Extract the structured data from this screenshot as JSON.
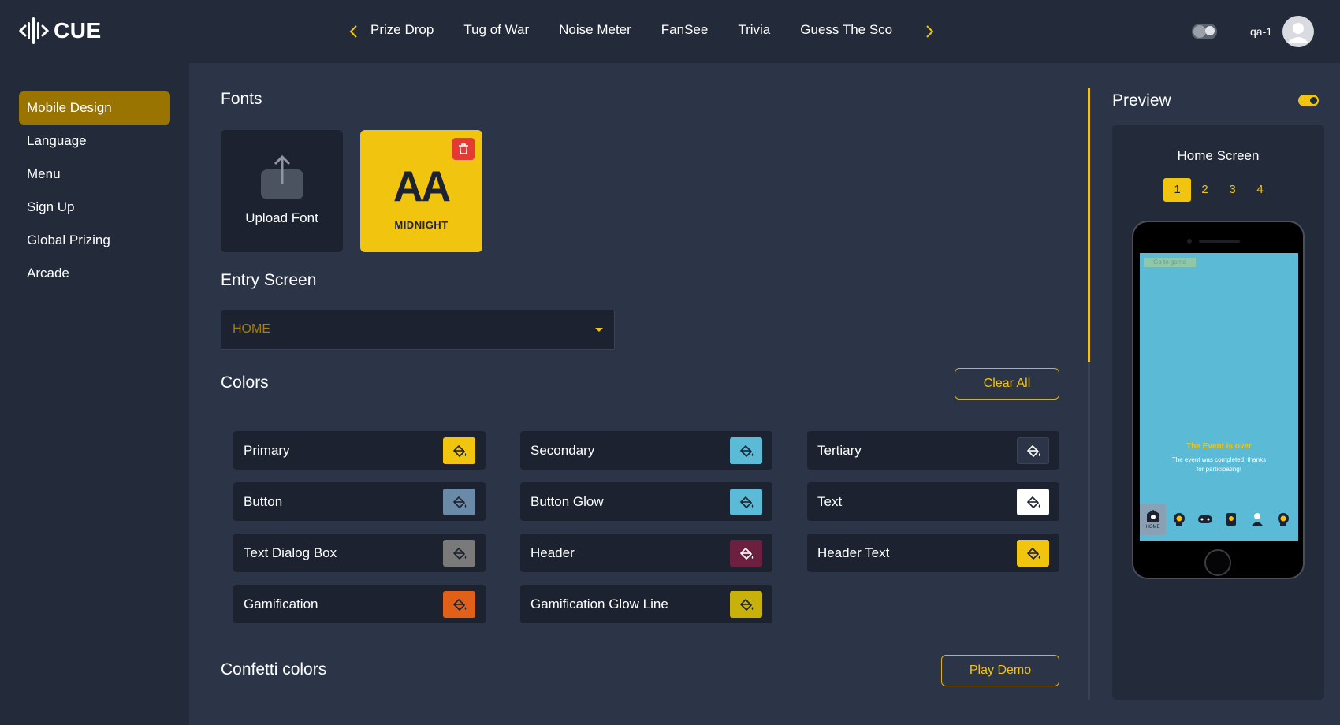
{
  "app": {
    "logo_text": "CUE"
  },
  "nav": {
    "tabs": [
      "Prize Drop",
      "Tug of War",
      "Noise Meter",
      "FanSee",
      "Trivia",
      "Guess The Sco"
    ]
  },
  "user": {
    "name": "qa-1"
  },
  "sidebar": {
    "items": [
      {
        "label": "Mobile Design",
        "active": true
      },
      {
        "label": "Language",
        "active": false
      },
      {
        "label": "Menu",
        "active": false
      },
      {
        "label": "Sign Up",
        "active": false
      },
      {
        "label": "Global Prizing",
        "active": false
      },
      {
        "label": "Arcade",
        "active": false
      }
    ]
  },
  "fonts": {
    "title": "Fonts",
    "upload_label": "Upload Font",
    "selected_font": {
      "preview": "AA",
      "name": "MIDNIGHT"
    }
  },
  "entry_screen": {
    "title": "Entry Screen",
    "value": "HOME"
  },
  "colors": {
    "title": "Colors",
    "clear_label": "Clear All",
    "items": [
      {
        "name": "Primary",
        "color": "#f1c40f",
        "icon": "paint-bucket-icon"
      },
      {
        "name": "Secondary",
        "color": "#5bbad5",
        "icon": "paint-bucket-icon"
      },
      {
        "name": "Tertiary",
        "color": "#2c3548",
        "icon": "paint-bucket-icon"
      },
      {
        "name": "Button",
        "color": "#6a8aa8",
        "icon": "paint-bucket-icon"
      },
      {
        "name": "Button Glow",
        "color": "#5bbad5",
        "icon": "paint-bucket-icon"
      },
      {
        "name": "Text",
        "color": "#ffffff",
        "icon": "paint-bucket-icon"
      },
      {
        "name": "Text Dialog Box",
        "color": "#7a7a7a",
        "icon": "paint-bucket-icon"
      },
      {
        "name": "Header",
        "color": "#6b2040",
        "icon": "paint-bucket-icon"
      },
      {
        "name": "Header Text",
        "color": "#f1c40f",
        "icon": "paint-bucket-icon"
      },
      {
        "name": "Gamification",
        "color": "#e0601a",
        "icon": "paint-bucket-icon"
      },
      {
        "name": "Gamification Glow Line",
        "color": "#c9b10c",
        "icon": "paint-bucket-icon"
      }
    ]
  },
  "confetti": {
    "title": "Confetti colors",
    "demo_label": "Play Demo"
  },
  "preview": {
    "title": "Preview",
    "screen_name": "Home Screen",
    "pages": [
      "1",
      "2",
      "3",
      "4"
    ],
    "active_page": "1",
    "phone": {
      "go_to_game": "Go to game",
      "event_title": "The Event is over",
      "event_message": "The event was completed, thanks for participating!",
      "nav_home_label": "HOME"
    }
  },
  "theme": {
    "accent": "#f1c40f",
    "bg": "#2c3548",
    "panel": "#232b3a",
    "card": "#1c2230"
  }
}
